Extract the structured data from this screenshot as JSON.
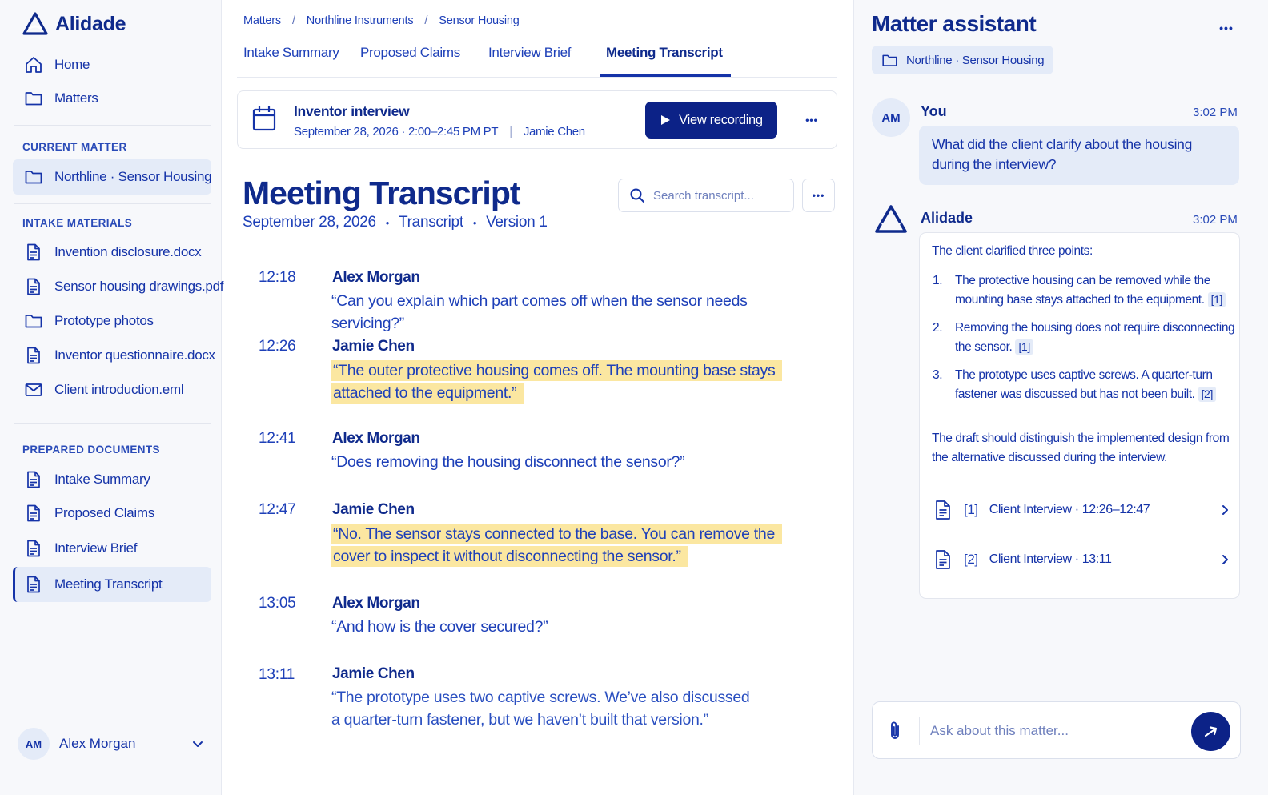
{
  "brand": {
    "name": "Alidade"
  },
  "sidebar": {
    "nav": [
      {
        "label": "Home",
        "icon": "home-icon"
      },
      {
        "label": "Matters",
        "icon": "folder-icon"
      }
    ],
    "current_matter_label": "CURRENT MATTER",
    "current_matter": {
      "label": "Northline · Sensor Housing",
      "icon": "folder-icon"
    },
    "intake_label": "INTAKE MATERIALS",
    "intake": [
      {
        "label": "Invention disclosure.docx",
        "icon": "document-icon"
      },
      {
        "label": "Sensor housing drawings.pdf",
        "icon": "document-icon"
      },
      {
        "label": "Prototype photos",
        "icon": "folder-icon"
      },
      {
        "label": "Inventor questionnaire.docx",
        "icon": "document-icon"
      },
      {
        "label": "Client introduction.eml",
        "icon": "mail-icon"
      }
    ],
    "prepared_label": "PREPARED DOCUMENTS",
    "prepared": [
      {
        "label": "Intake Summary",
        "icon": "document-icon"
      },
      {
        "label": "Proposed Claims",
        "icon": "document-icon"
      },
      {
        "label": "Interview Brief",
        "icon": "document-icon"
      },
      {
        "label": "Meeting Transcript",
        "icon": "document-icon",
        "active": true
      }
    ],
    "user": {
      "initials": "AM",
      "name": "Alex Morgan"
    }
  },
  "breadcrumb": [
    "Matters",
    "/",
    "Northline Instruments",
    "/",
    "Sensor Housing"
  ],
  "tabs": [
    {
      "label": "Intake Summary"
    },
    {
      "label": "Proposed Claims"
    },
    {
      "label": "Interview Brief"
    },
    {
      "label": "Meeting Transcript",
      "active": true
    }
  ],
  "meeting": {
    "title": "Inventor interview",
    "datetime": "September 28, 2026 · 2:00–2:45 PM PT",
    "separator": "|",
    "participant": "Jamie Chen",
    "view_recording": "View recording",
    "more": "•••"
  },
  "document": {
    "title": "Meeting Transcript",
    "date": "September 28, 2026",
    "dot": "•",
    "type": "Transcript",
    "version": "Version 1",
    "search_placeholder": "Search transcript...",
    "more": "•••"
  },
  "transcript": [
    {
      "time": "12:18",
      "speaker": "Alex Morgan",
      "text": "“Can you explain which part comes off when the sensor needs servicing?”",
      "highlight": false
    },
    {
      "time": "12:26",
      "speaker": "Jamie Chen",
      "text": "“The outer protective housing comes off. The mounting base stays attached to the equipment.”",
      "highlight": true
    },
    {
      "time": "12:41",
      "speaker": "Alex Morgan",
      "text": "“Does removing the housing disconnect the sensor?”",
      "highlight": false
    },
    {
      "time": "12:47",
      "speaker": "Jamie Chen",
      "text": "“No. The sensor stays connected to the base. You can remove the cover to inspect it without disconnecting the sensor.”",
      "highlight": true
    },
    {
      "time": "13:05",
      "speaker": "Alex Morgan",
      "text": "“And how is the cover secured?”",
      "highlight": false
    },
    {
      "time": "13:11",
      "speaker": "Jamie Chen",
      "text": "“The prototype uses two captive screws. We’ve also discussed a quarter-turn fastener, but we haven’t built that version.”",
      "highlight": false
    }
  ],
  "assistant": {
    "title": "Matter assistant",
    "more": "•••",
    "context_chip": "Northline · Sensor Housing",
    "user_msg": {
      "initials": "AM",
      "name": "You",
      "time": "3:02 PM",
      "text": "What did the client clarify about the housing during the interview?"
    },
    "ai_msg": {
      "name": "Alidade",
      "time": "3:02 PM",
      "intro": "The client clarified three points:",
      "points": [
        {
          "num": "1.",
          "text": "The protective housing can be removed while the mounting base stays attached to the equipment.",
          "cite": "[1]"
        },
        {
          "num": "2.",
          "text": "Removing the housing does not require disconnecting the sensor.",
          "cite": "[1]"
        },
        {
          "num": "3.",
          "text": "The prototype uses captive screws. A quarter-turn fastener was discussed but has not been built.",
          "cite": "[2]"
        }
      ],
      "closing": "The draft should distinguish the implemented design from the alternative discussed during the interview.",
      "sources": [
        {
          "ref": "[1]",
          "label": "Client Interview · 12:26–12:47"
        },
        {
          "ref": "[2]",
          "label": "Client Interview · 13:11"
        }
      ]
    },
    "composer_placeholder": "Ask about this matter..."
  },
  "colors": {
    "accent": "#0c2287",
    "text": "#1533a8",
    "highlight": "#fbe7a1",
    "sidebar_bg": "#f7f8fb",
    "active_bg": "#e4ebf8"
  }
}
